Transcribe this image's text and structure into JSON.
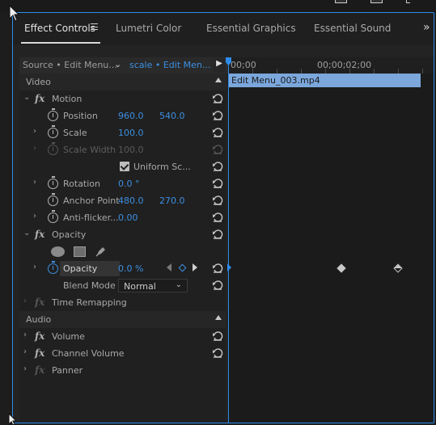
{
  "tabs": [
    {
      "label": "Effect Controls"
    },
    {
      "label": "Lumetri Color"
    },
    {
      "label": "Essential Graphics"
    },
    {
      "label": "Essential Sound"
    }
  ],
  "tab_overflow": "»",
  "source": {
    "left": "Source • Edit Menu...",
    "right": "scale • Edit Men..."
  },
  "timeline": {
    "timecodes": [
      "00;00",
      "00;00;02;00"
    ],
    "clip_name": "Edit Menu_003.mp4"
  },
  "sections": {
    "video": "Video",
    "audio": "Audio"
  },
  "effects": {
    "motion": {
      "name": "Motion",
      "position": {
        "label": "Position",
        "x": "960.0",
        "y": "540.0"
      },
      "scale": {
        "label": "Scale",
        "value": "100.0"
      },
      "scale_width": {
        "label": "Scale Width",
        "value": "100.0"
      },
      "uniform_scale": {
        "label": "Uniform Sc...",
        "checked": true
      },
      "rotation": {
        "label": "Rotation",
        "value": "0.0 °"
      },
      "anchor_point": {
        "label": "Anchor Point",
        "x": "480.0",
        "y": "270.0"
      },
      "anti_flicker": {
        "label": "Anti-flicker...",
        "value": "0.00"
      }
    },
    "opacity": {
      "name": "Opacity",
      "opacity": {
        "label": "Opacity",
        "value": "0.0 %"
      },
      "blend_mode": {
        "label": "Blend Mode",
        "value": "Normal"
      }
    },
    "time_remapping": "Time Remapping",
    "volume": "Volume",
    "channel_volume": "Channel Volume",
    "panner": "Panner"
  },
  "colors": {
    "accent": "#2d8ceb",
    "value_blue": "#3c8fe0",
    "clip": "#7ba7dc"
  }
}
